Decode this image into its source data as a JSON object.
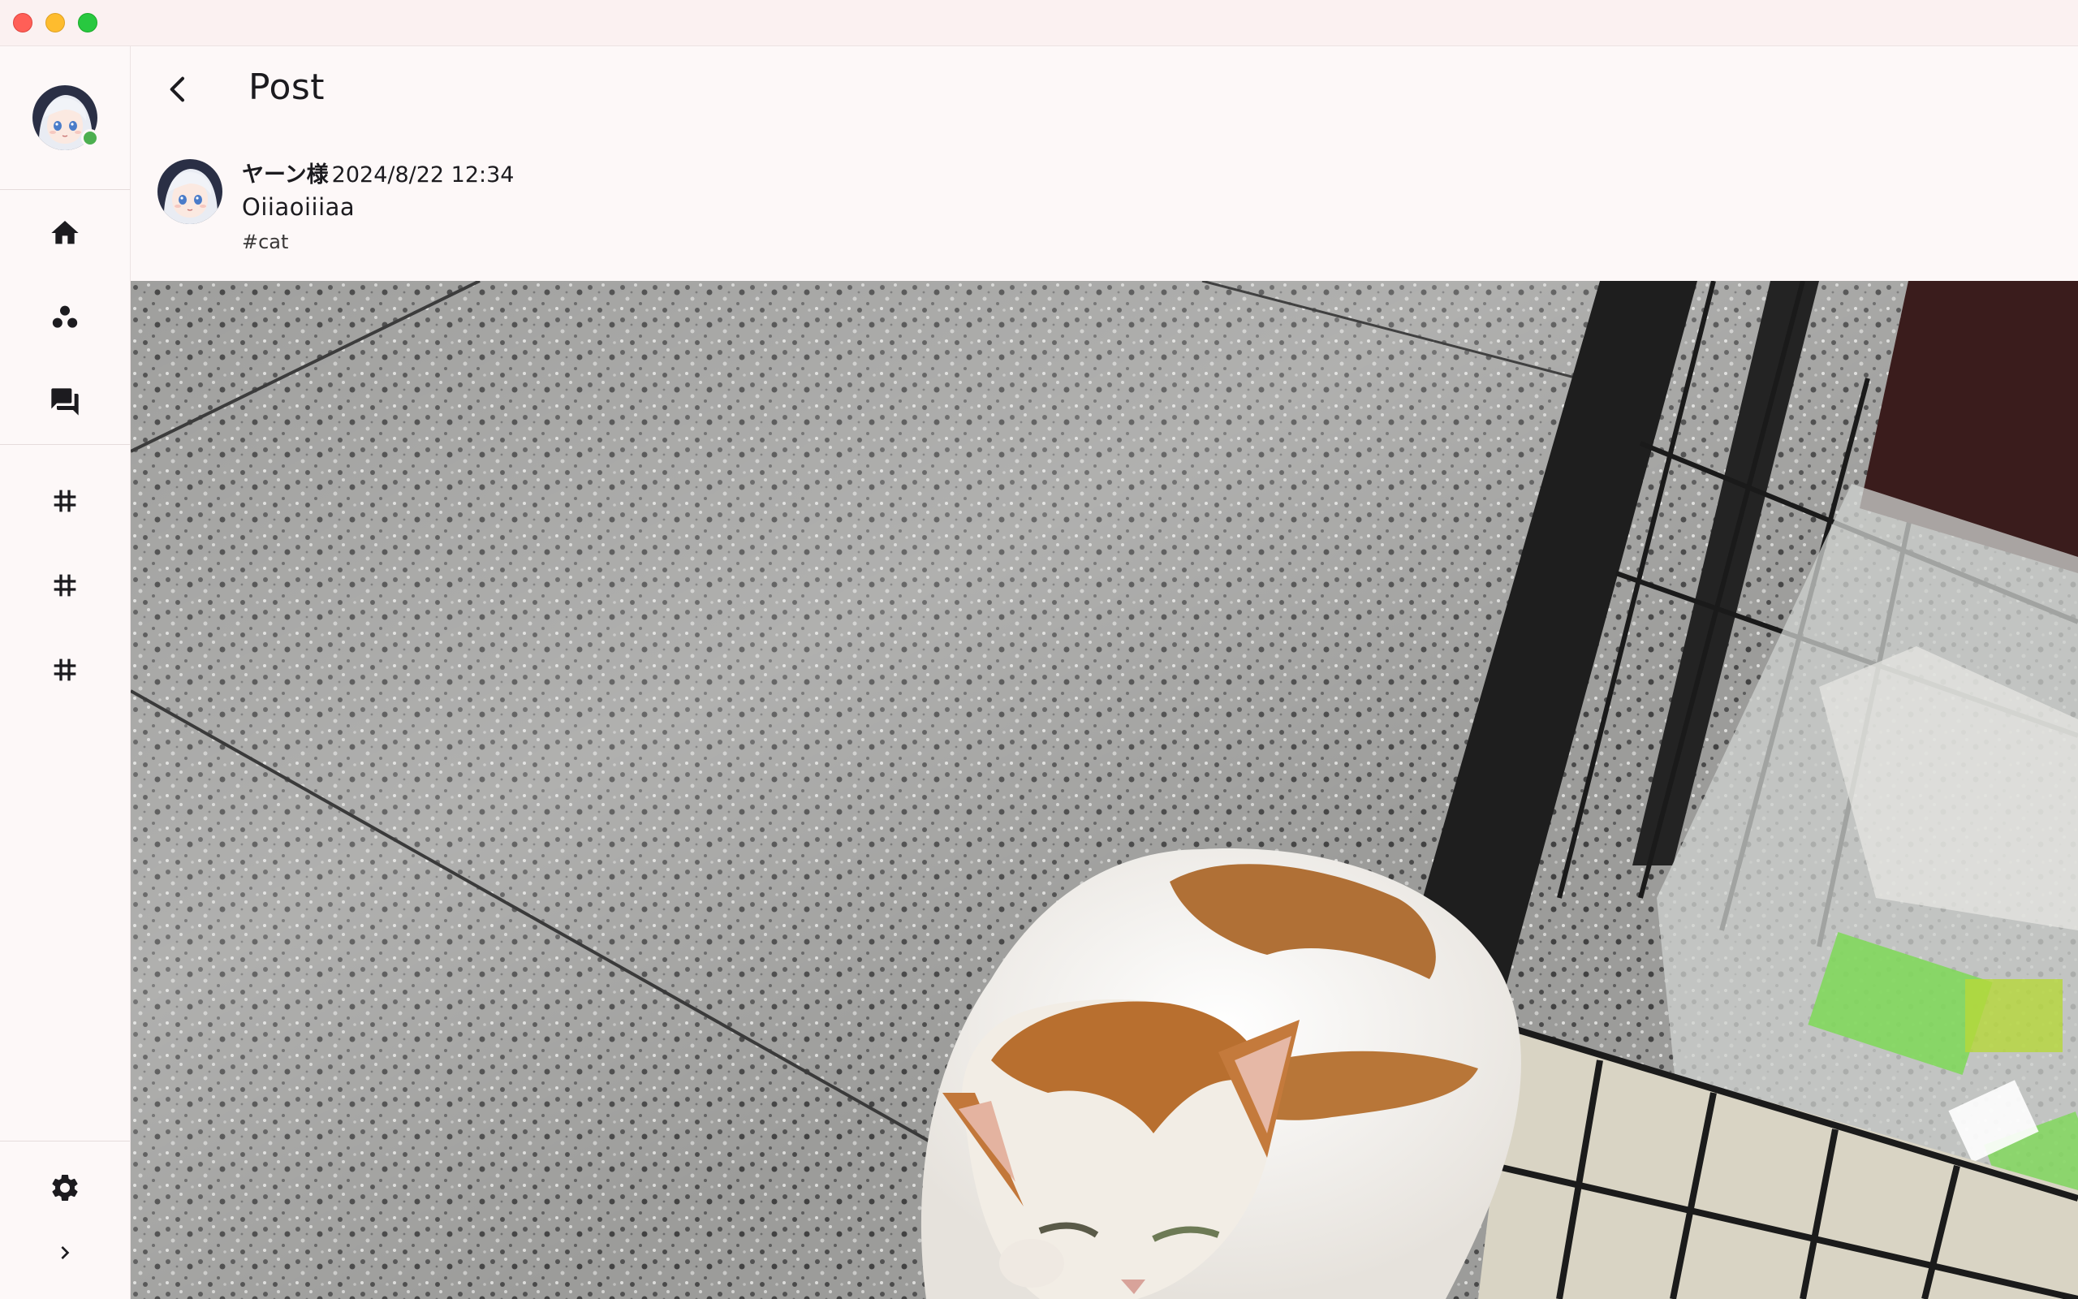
{
  "window": {
    "controls": [
      "close",
      "minimize",
      "maximize"
    ]
  },
  "sidebar": {
    "profile_status": "online",
    "nav": [
      {
        "icon": "home-icon"
      },
      {
        "icon": "communities-icon"
      },
      {
        "icon": "chat-icon"
      }
    ],
    "channels": [
      {
        "icon": "hashtag-icon"
      },
      {
        "icon": "hashtag-icon"
      },
      {
        "icon": "hashtag-icon"
      }
    ],
    "bottom": [
      {
        "icon": "gear-icon"
      },
      {
        "icon": "chevron-right-icon"
      }
    ]
  },
  "header": {
    "back_icon": "chevron-left-icon",
    "title": "Post"
  },
  "post": {
    "author": "ヤーン様",
    "timestamp": "2024/8/22 12:34",
    "text": "Oiiaoiiiaa",
    "tag": "#cat",
    "image_subject": "cat-photo"
  },
  "colors": {
    "background": "#fdf8f8",
    "titlebar": "#fbf1f1",
    "text": "#1c1b1f",
    "online": "#4caf50",
    "close": "#ff5f57",
    "minimize": "#febc2e",
    "maximize": "#28c840"
  }
}
